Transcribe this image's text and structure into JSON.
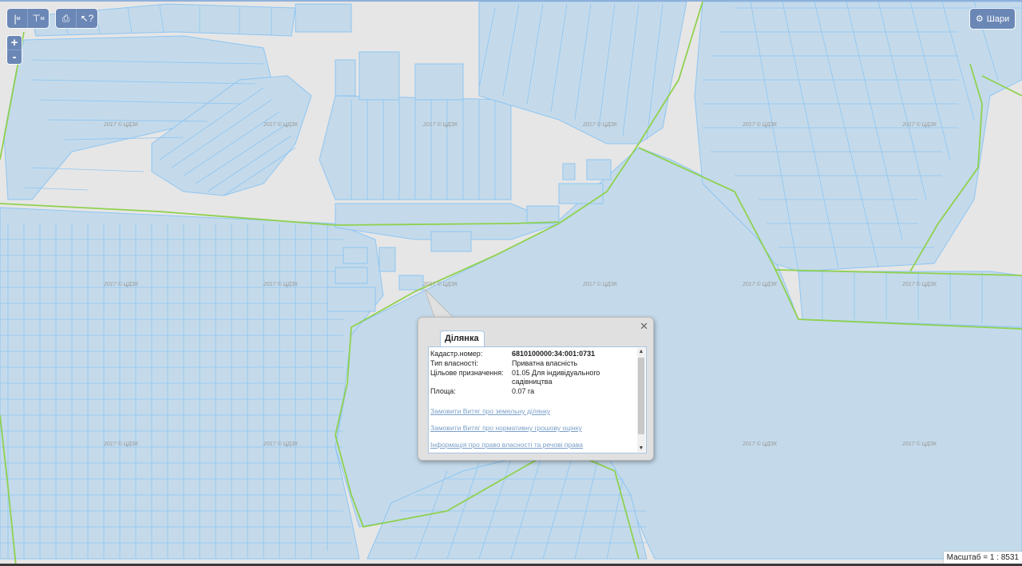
{
  "toolbar": {
    "ruler_label": "м",
    "area_label": "м",
    "print_icon": "printer-icon",
    "identify_icon": "cursor-help-icon"
  },
  "zoom": {
    "in_label": "+",
    "out_label": "-"
  },
  "layers_button": {
    "icon": "gear-icon",
    "label": "Шари"
  },
  "watermark": "2017 © ЦДЗК",
  "popup": {
    "tab_label": "Ділянка",
    "fields": [
      {
        "key": "Кадастр.номер:",
        "value": "6810100000:34:001:0731",
        "bold": true
      },
      {
        "key": "Тип власності:",
        "value": "Приватна власність",
        "bold": false
      },
      {
        "key": "Цільове призначення:",
        "value": "01.05 Для індивідуального садівництва",
        "bold": false
      },
      {
        "key": "Площа:",
        "value": "0.07 га",
        "bold": false
      }
    ],
    "links": [
      "Замовити Витяг про земельну ділянку",
      "Замовити Витяг про нормативну грошову оцінку",
      "Інформація про право власності та речові права"
    ]
  },
  "scale": {
    "label": "Масштаб = 1 : 8531"
  },
  "colors": {
    "parcel_fill": "#c4daea",
    "parcel_stroke": "#8ec5f2",
    "boundary_line": "#8fd14f",
    "background": "#e6e6e6",
    "button": "#6b87b6"
  }
}
